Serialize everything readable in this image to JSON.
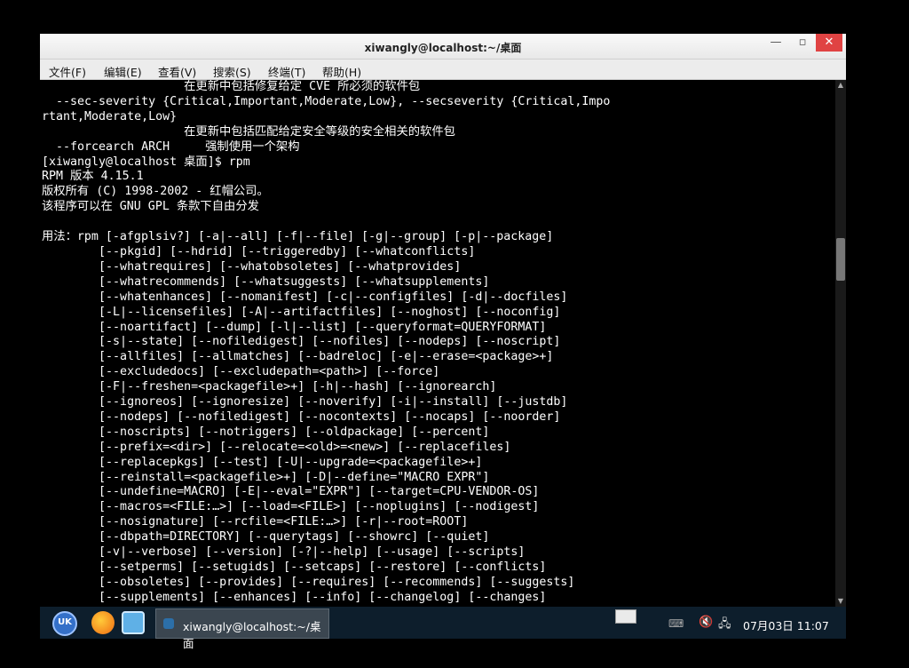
{
  "window": {
    "title": "xiwangly@localhost:~/桌面",
    "minimize_label": "—",
    "maximize_label": "▫",
    "close_label": "✕"
  },
  "menubar": {
    "file": "文件(F)",
    "edit": "编辑(E)",
    "view": "查看(V)",
    "search": "搜索(S)",
    "terminal": "终端(T)",
    "help": "帮助(H)"
  },
  "terminal_lines": [
    "                    在更新中包括修复给定 CVE 所必须的软件包",
    "  --sec-severity {Critical,Important,Moderate,Low}, --secseverity {Critical,Impo",
    "rtant,Moderate,Low}",
    "                    在更新中包括匹配给定安全等级的安全相关的软件包",
    "  --forcearch ARCH     强制使用一个架构",
    "[xiwangly@localhost 桌面]$ rpm",
    "RPM 版本 4.15.1",
    "版权所有 (C) 1998-2002 - 红帽公司。",
    "该程序可以在 GNU GPL 条款下自由分发",
    "",
    "用法：rpm [-afgplsiv?] [-a|--all] [-f|--file] [-g|--group] [-p|--package]",
    "        [--pkgid] [--hdrid] [--triggeredby] [--whatconflicts]",
    "        [--whatrequires] [--whatobsoletes] [--whatprovides]",
    "        [--whatrecommends] [--whatsuggests] [--whatsupplements]",
    "        [--whatenhances] [--nomanifest] [-c|--configfiles] [-d|--docfiles]",
    "        [-L|--licensefiles] [-A|--artifactfiles] [--noghost] [--noconfig]",
    "        [--noartifact] [--dump] [-l|--list] [--queryformat=QUERYFORMAT]",
    "        [-s|--state] [--nofiledigest] [--nofiles] [--nodeps] [--noscript]",
    "        [--allfiles] [--allmatches] [--badreloc] [-e|--erase=<package>+]",
    "        [--excludedocs] [--excludepath=<path>] [--force]",
    "        [-F|--freshen=<packagefile>+] [-h|--hash] [--ignorearch]",
    "        [--ignoreos] [--ignoresize] [--noverify] [-i|--install] [--justdb]",
    "        [--nodeps] [--nofiledigest] [--nocontexts] [--nocaps] [--noorder]",
    "        [--noscripts] [--notriggers] [--oldpackage] [--percent]",
    "        [--prefix=<dir>] [--relocate=<old>=<new>] [--replacefiles]",
    "        [--replacepkgs] [--test] [-U|--upgrade=<packagefile>+]",
    "        [--reinstall=<packagefile>+] [-D|--define=\"MACRO EXPR\"]",
    "        [--undefine=MACRO] [-E|--eval=\"EXPR\"] [--target=CPU-VENDOR-OS]",
    "        [--macros=<FILE:…>] [--load=<FILE>] [--noplugins] [--nodigest]",
    "        [--nosignature] [--rcfile=<FILE:…>] [-r|--root=ROOT]",
    "        [--dbpath=DIRECTORY] [--querytags] [--showrc] [--quiet]",
    "        [-v|--verbose] [--version] [-?|--help] [--usage] [--scripts]",
    "        [--setperms] [--setugids] [--setcaps] [--restore] [--conflicts]",
    "        [--obsoletes] [--provides] [--requires] [--recommends] [--suggests]",
    "        [--supplements] [--enhances] [--info] [--changelog] [--changes]"
  ],
  "taskbar": {
    "start_icon_name": "deepin-launcher-icon",
    "start_label": "UK",
    "task_label": "xiwangly@localhost:~/桌面",
    "clock": "07月03日 11:07",
    "volume_glyph": "🔇",
    "network_glyph": "🖧",
    "keyboard_glyph": "⌨"
  }
}
